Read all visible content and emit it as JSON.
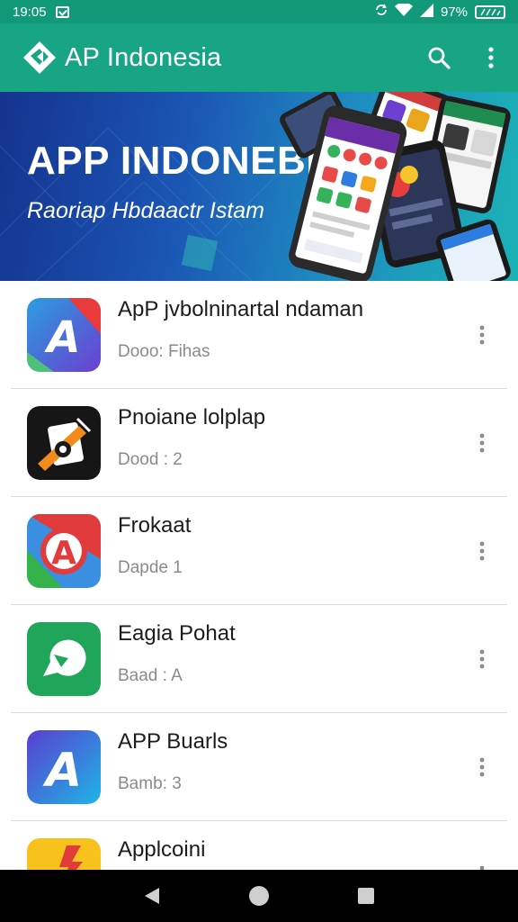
{
  "status_bar": {
    "time": "19:05",
    "battery": "97%",
    "icons": [
      "notification-icon",
      "sync-icon",
      "wifi-icon",
      "signal-icon",
      "battery-icon"
    ]
  },
  "app_bar": {
    "title": "AP Indonesia",
    "icons": [
      "app-logo",
      "search-icon",
      "more-vertical-icon"
    ]
  },
  "banner": {
    "title": "APP INDONEBIA",
    "subtitle": "Raoriap Hbdaactr Istam"
  },
  "apps": [
    {
      "name": "ApP jvbolninartal ndaman",
      "meta": "Dooo: Fihas",
      "icon": "app-icon-blue-a",
      "colors": [
        "#e93b3b",
        "#2a9de0",
        "#6b3fd0"
      ]
    },
    {
      "name": "Pnoiane lolplap",
      "meta": "Dood : 2",
      "icon": "app-icon-camera",
      "colors": [
        "#1a1a1a",
        "#f28a1c",
        "#ffffff"
      ]
    },
    {
      "name": "Frokaat",
      "meta": "Dapde 1",
      "icon": "app-icon-red-a",
      "colors": [
        "#e23b3b",
        "#3a8fe0",
        "#35b34a"
      ]
    },
    {
      "name": "Eagia Pohat",
      "meta": "Baad : A",
      "icon": "app-icon-green-chat",
      "colors": [
        "#1fa65a",
        "#ffffff"
      ]
    },
    {
      "name": "APP Buarls",
      "meta": "Bamb: 3",
      "icon": "app-icon-gradient-a",
      "colors": [
        "#5a3fd0",
        "#1eb4e6"
      ]
    },
    {
      "name": "Applcoini",
      "meta": "",
      "icon": "app-icon-yellow",
      "colors": [
        "#f6c21b",
        "#e23b3b",
        "#1e5fd6"
      ]
    }
  ],
  "nav_bar": {
    "icons": [
      "back-icon",
      "home-icon",
      "recents-icon"
    ]
  },
  "colors": {
    "primary": "#17a583",
    "status_bar": "#129a78",
    "banner_start": "#14338e",
    "banner_end": "#1bb3b6"
  }
}
